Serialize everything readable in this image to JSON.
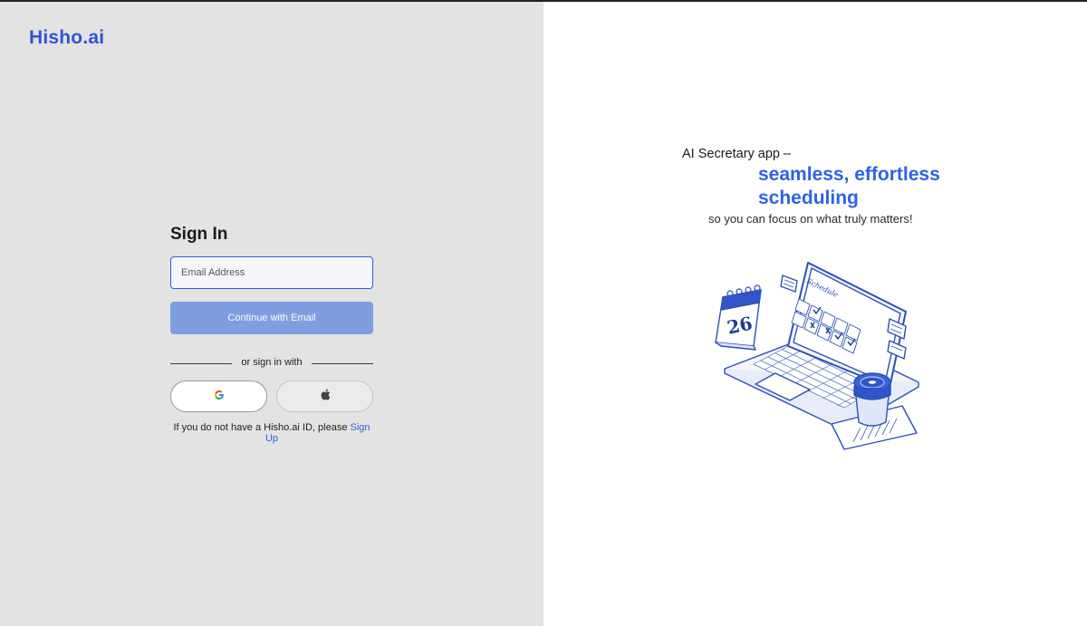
{
  "brand": {
    "logo_text": "Hisho.ai",
    "accent_color": "#2b63e6",
    "bg_left": "#e3e3e3"
  },
  "signin": {
    "title": "Sign In",
    "email_placeholder": "Email Address",
    "continue_label": "Continue with Email",
    "divider_text": "or sign in with",
    "google_icon": "google-icon",
    "apple_icon": "apple-icon",
    "signup_prompt": "If you do not have a Hisho.ai ID, please",
    "signup_link": "Sign Up"
  },
  "promo": {
    "line1": "AI Secretary app –",
    "line2": "seamless, effortless",
    "line3": "scheduling",
    "line4": "so you can focus on what truly matters!",
    "illustration": {
      "schedule_label": "Schedule",
      "calendar_day": "26"
    }
  }
}
